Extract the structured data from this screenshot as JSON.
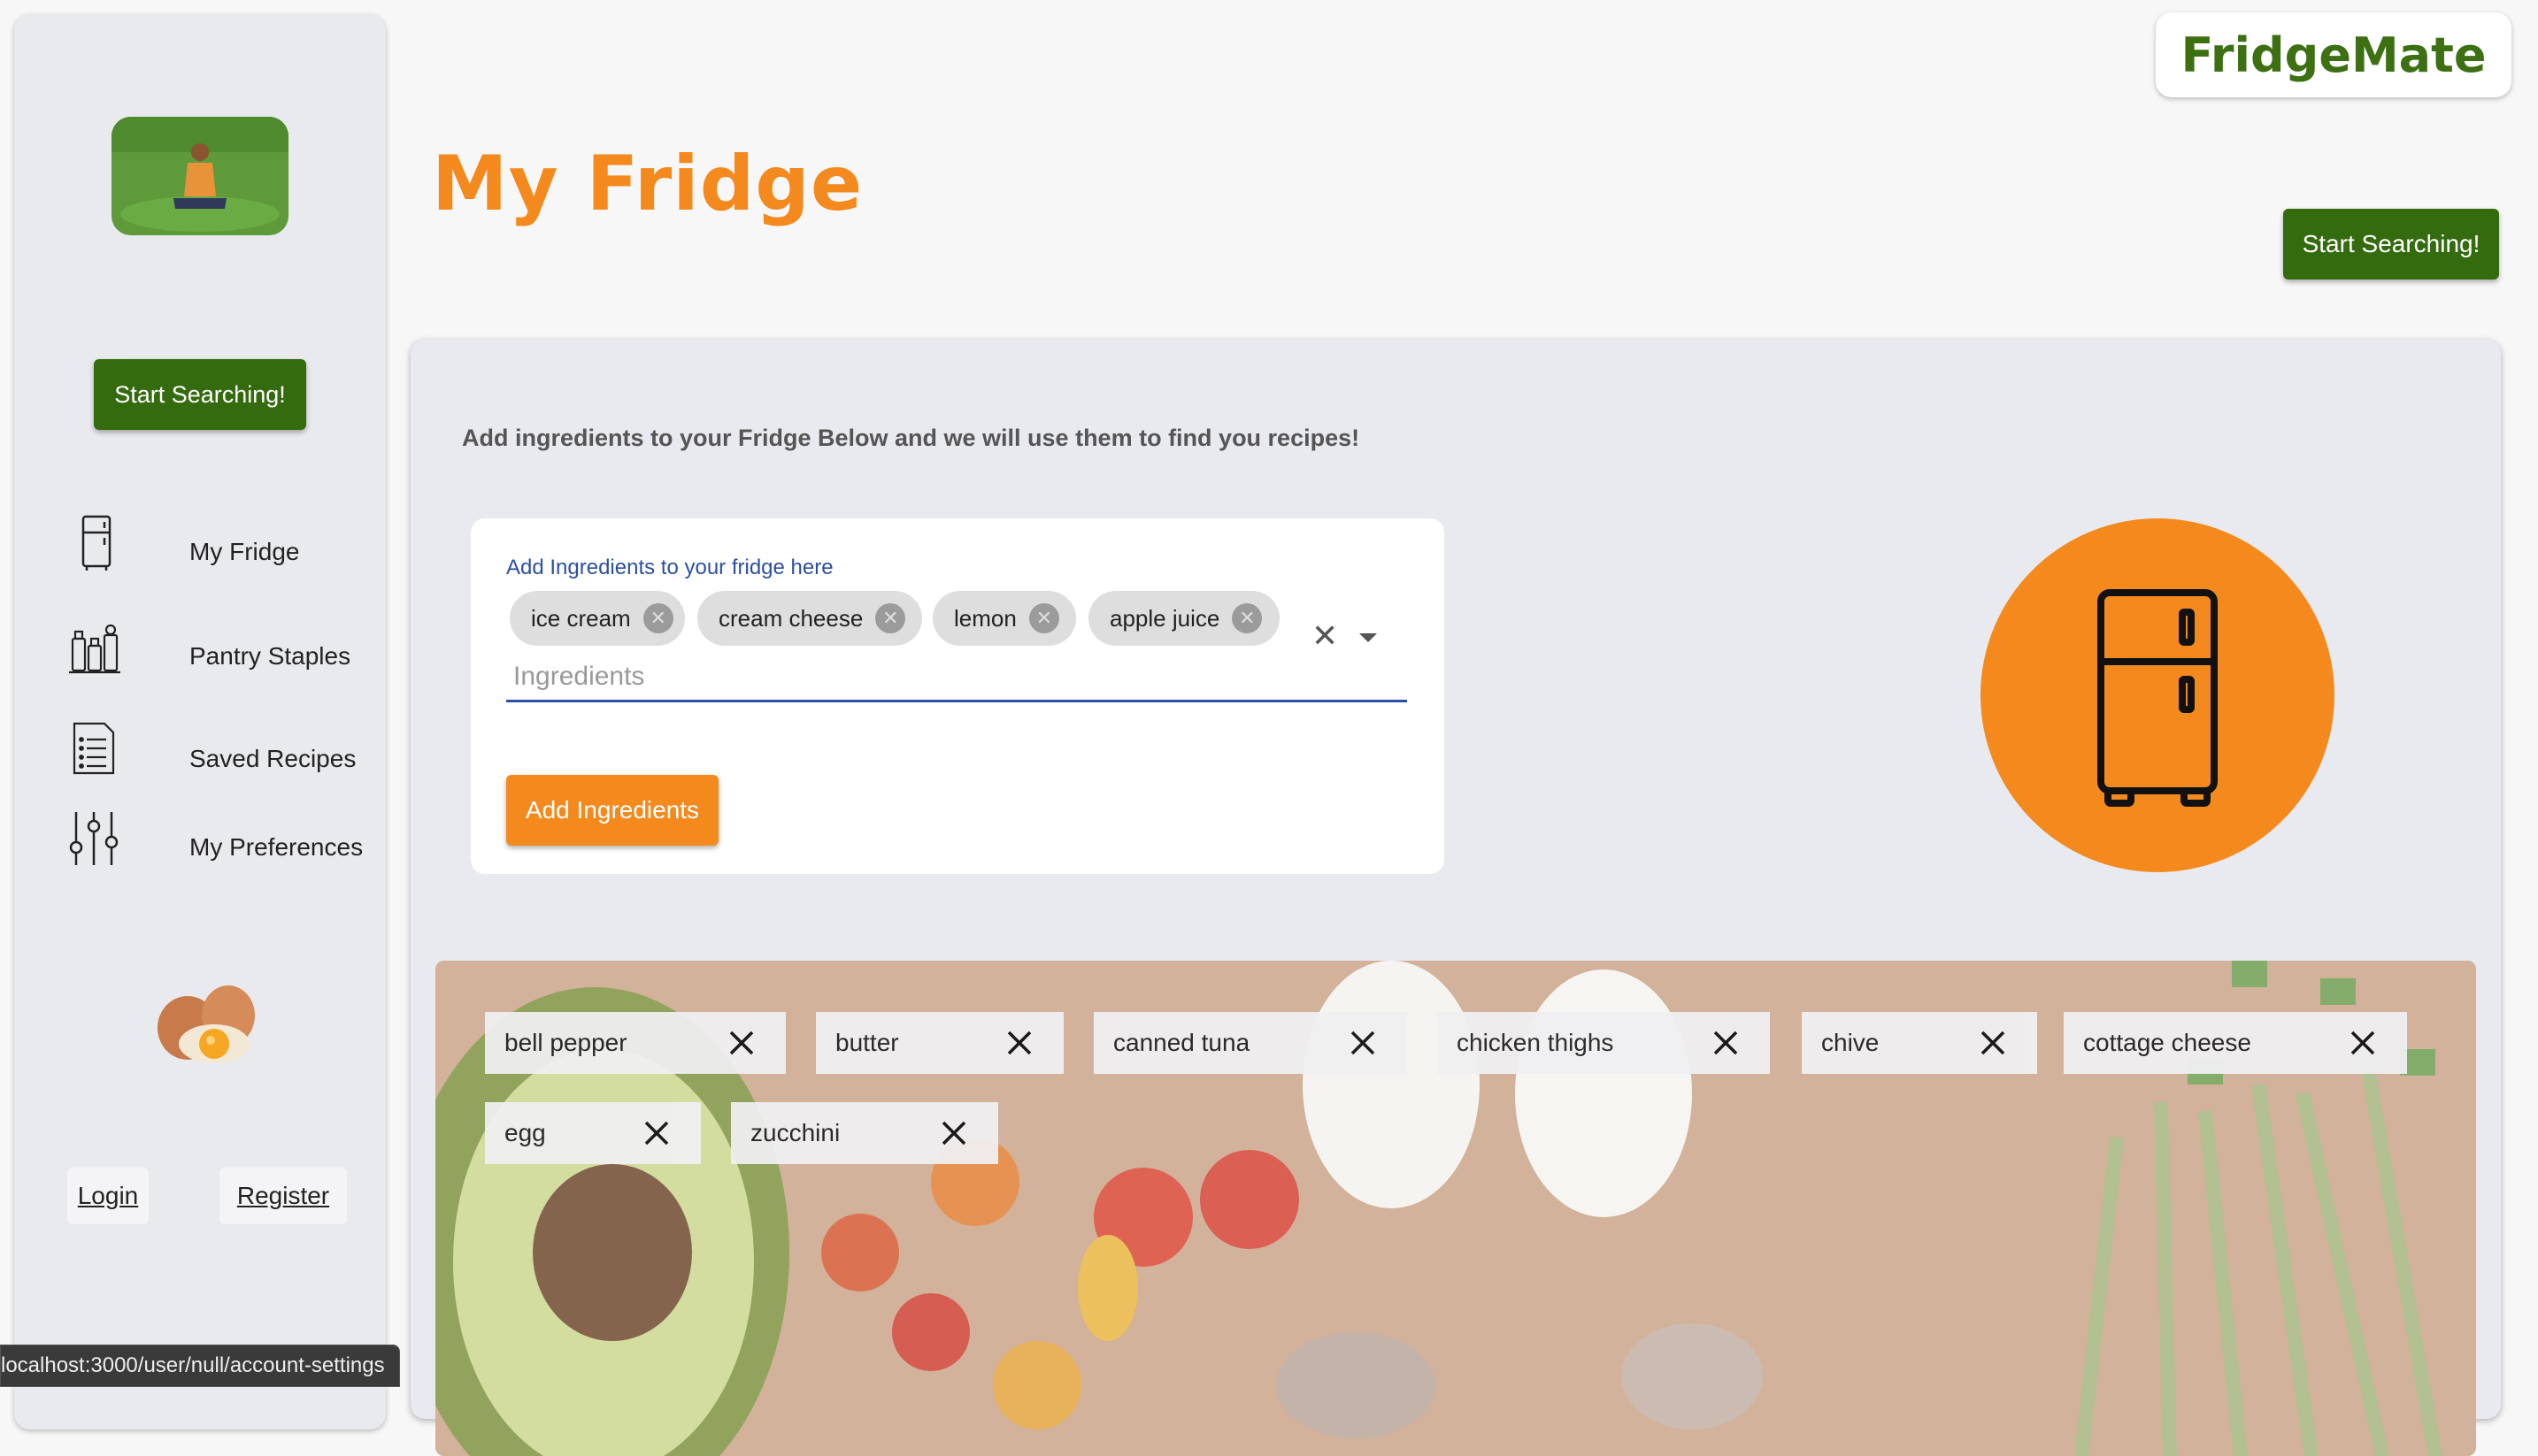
{
  "sidebar": {
    "start_search_label": "Start Searching!",
    "nav": [
      {
        "label": "My Fridge",
        "icon": "fridge-icon"
      },
      {
        "label": "Pantry Staples",
        "icon": "pantry-icon"
      },
      {
        "label": "Saved Recipes",
        "icon": "list-icon"
      },
      {
        "label": "My Preferences",
        "icon": "sliders-icon"
      }
    ],
    "login_label": "Login",
    "register_label": "Register"
  },
  "header": {
    "logo": "FridgeMate",
    "title": "My Fridge",
    "start_search_label": "Start Searching!"
  },
  "main": {
    "instructions": "Add ingredients to your Fridge Below and we will use them to find you recipes!",
    "input_label": "Add Ingredients to your fridge here",
    "input_placeholder": "Ingredients",
    "selected_chips": [
      "ice cream",
      "cream cheese",
      "lemon",
      "apple juice"
    ],
    "add_button_label": "Add Ingredients"
  },
  "fridge_items": [
    "bell pepper",
    "butter",
    "canned tuna",
    "chicken thighs",
    "chive",
    "cottage cheese",
    "egg",
    "zucchini"
  ],
  "status_bar": "localhost:3000/user/null/account-settings",
  "colors": {
    "accent_orange": "#f48a1e",
    "brand_green": "#346b0e",
    "panel_bg": "#e9eaf0"
  }
}
